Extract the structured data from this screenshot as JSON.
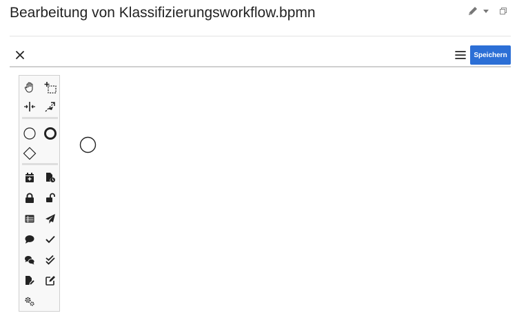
{
  "header": {
    "title": "Bearbeitung von Klassifizierungsworkflow.bpmn"
  },
  "title_actions": {
    "icons": [
      "pencil-icon",
      "caret-down-icon",
      "restore-window-icon"
    ]
  },
  "toolbar": {
    "close_icon": "close-icon",
    "menu_icon": "hamburger-menu-icon",
    "save_label": "Speichern",
    "save_color": "#2c6fd6"
  },
  "palette": {
    "groups": [
      [
        "hand-tool-icon",
        "lasso-tool-icon",
        "space-tool-icon",
        "global-connect-tool-icon"
      ],
      [
        "start-event-icon",
        "end-event-icon",
        "gateway-icon"
      ],
      [
        "calendar-plus-icon",
        "file-clock-icon",
        "lock-icon",
        "unlock-icon",
        "table-list-icon",
        "paper-plane-icon",
        "comment-icon",
        "check-icon",
        "comments-icon",
        "double-check-icon",
        "file-signature-icon",
        "edit-icon",
        "cogs-icon"
      ]
    ]
  },
  "canvas": {
    "elements": [
      "start-event"
    ]
  }
}
